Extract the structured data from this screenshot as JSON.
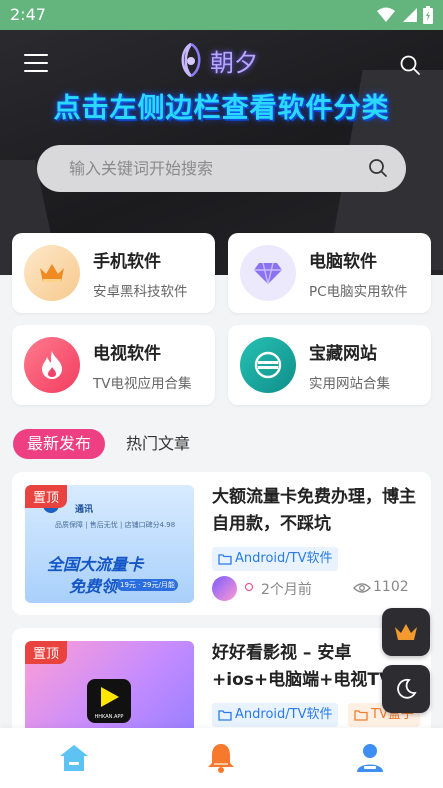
{
  "status_bar": {
    "time": "2:47"
  },
  "header": {
    "logo_text": "朝夕",
    "headline": "点击左侧边栏查看软件分类",
    "search_placeholder": "输入关键词开始搜索"
  },
  "categories": [
    {
      "title": "手机软件",
      "subtitle": "安卓黑科技软件",
      "icon": "crown-icon",
      "color": "#f29b3a"
    },
    {
      "title": "电脑软件",
      "subtitle": "PC电脑实用软件",
      "icon": "diamond-icon",
      "color": "#8a72f0"
    },
    {
      "title": "电视软件",
      "subtitle": "TV电视应用合集",
      "icon": "flame-icon",
      "color": "#f2446b"
    },
    {
      "title": "宝藏网站",
      "subtitle": "实用网站合集",
      "icon": "globe-icon",
      "color": "#1aa9a2"
    }
  ],
  "tabs": {
    "active": "最新发布",
    "other": "热门文章"
  },
  "articles": [
    {
      "pin": "置顶",
      "title": "大额流量卡免费办理，博主自用款，不踩坑",
      "tags": [
        "Android/TV软件"
      ],
      "time": "2个月前",
      "views": "1102",
      "thumb": {
        "brand": "通讯",
        "line": "品质保障 | 售后无忧 | 店铺口碑分4.98",
        "big1": "全国大流量卡",
        "big2": "免费领",
        "price": "19元 · 29元/月能"
      }
    },
    {
      "pin": "置顶",
      "title": "好好看影视 – 安卓+ios+电脑端+电视TV版",
      "tags": [
        "Android/TV软件",
        "TV盒子"
      ],
      "thumb": {
        "app": "HHKAN.APP"
      }
    }
  ],
  "colors": {
    "accent": "#ee3f82",
    "tag_blue": "#2a7be6",
    "status_bar": "#64b47e"
  }
}
